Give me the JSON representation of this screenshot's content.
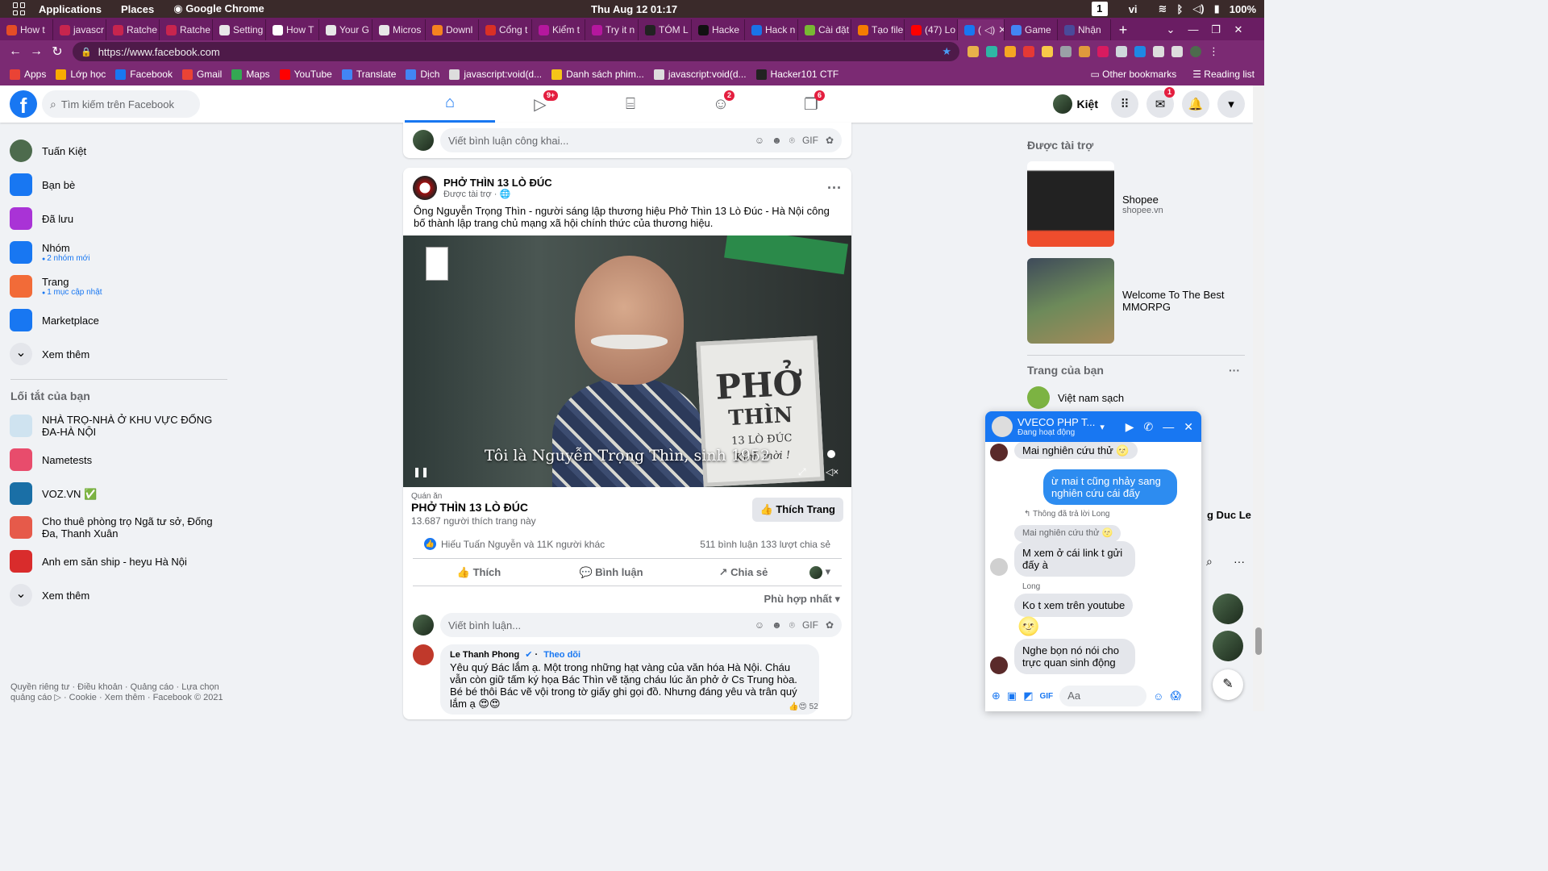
{
  "system": {
    "menus": [
      "Applications",
      "Places",
      "Google Chrome"
    ],
    "clock": "Thu Aug 12  01:17",
    "workspace": "1",
    "lang": "vi",
    "battery": "100%"
  },
  "tabs": [
    {
      "label": "How t",
      "color": "#e44d26"
    },
    {
      "label": "javascr",
      "color": "#c7254e"
    },
    {
      "label": "Ratche",
      "color": "#c7254e"
    },
    {
      "label": "Ratche",
      "color": "#c7254e"
    },
    {
      "label": "Setting",
      "color": "#e7e7e7"
    },
    {
      "label": "How T",
      "color": "#ffffff"
    },
    {
      "label": "Your G",
      "color": "#e7e7e7"
    },
    {
      "label": "Micros",
      "color": "#e7e7e7"
    },
    {
      "label": "Downl",
      "color": "#f58220"
    },
    {
      "label": "Cổng t",
      "color": "#d93025"
    },
    {
      "label": "Kiểm t",
      "color": "#b5179e"
    },
    {
      "label": "Try it n",
      "color": "#b5179e"
    },
    {
      "label": "TÓM L",
      "color": "#222222"
    },
    {
      "label": "Hacke",
      "color": "#111111"
    },
    {
      "label": "Hack n",
      "color": "#1a73e8"
    },
    {
      "label": "Cài đặt",
      "color": "#78b833"
    },
    {
      "label": "Tạo file",
      "color": "#f57c00"
    },
    {
      "label": "(47) Lo",
      "color": "#ff0000"
    },
    {
      "label": "(",
      "color": "#1877f2"
    },
    {
      "label": "Game",
      "color": "#4285f4"
    },
    {
      "label": "Nhận",
      "color": "#4a4a9a"
    }
  ],
  "omnibox": {
    "url": "https://www.facebook.com"
  },
  "bookmarks": [
    {
      "label": "Apps",
      "color": "#ea4335"
    },
    {
      "label": "Lớp học",
      "color": "#f9ab00"
    },
    {
      "label": "Facebook",
      "color": "#1877f2"
    },
    {
      "label": "Gmail",
      "color": "#ea4335"
    },
    {
      "label": "Maps",
      "color": "#34a853"
    },
    {
      "label": "YouTube",
      "color": "#ff0000"
    },
    {
      "label": "Translate",
      "color": "#4285f4"
    },
    {
      "label": "Dịch",
      "color": "#4285f4"
    },
    {
      "label": "javascript:void(d...",
      "color": "#dddddd"
    },
    {
      "label": "Danh sách phim...",
      "color": "#f5c518"
    },
    {
      "label": "javascript:void(d...",
      "color": "#dddddd"
    },
    {
      "label": "Hacker101 CTF",
      "color": "#222222"
    }
  ],
  "bookmarks_right": [
    "Other bookmarks",
    "Reading list"
  ],
  "fb": {
    "search_placeholder": "Tìm kiếm trên Facebook",
    "nav_badges": {
      "watch": "9+",
      "groups": "2",
      "gaming": "6"
    },
    "profile_name": "Kiệt",
    "messenger_badge": "1"
  },
  "left": {
    "items": [
      {
        "label": "Tuấn Kiệt",
        "sub": "",
        "color": "#4d6b4d"
      },
      {
        "label": "Bạn bè",
        "sub": "",
        "color": "#1877f2"
      },
      {
        "label": "Đã lưu",
        "sub": "",
        "color": "#a933d6"
      },
      {
        "label": "Nhóm",
        "sub": "2 nhóm mới",
        "color": "#1877f2"
      },
      {
        "label": "Trang",
        "sub": "1 mục cập nhật",
        "color": "#f26b38"
      },
      {
        "label": "Marketplace",
        "sub": "",
        "color": "#1877f2"
      },
      {
        "label": "Xem thêm",
        "sub": "",
        "color": "#e4e6eb"
      }
    ],
    "shortcuts_title": "Lối tắt của bạn",
    "shortcuts": [
      {
        "label": "NHÀ TRỌ-NHÀ Ở KHU VỰC ĐỐNG ĐA-HÀ NỘI",
        "color": "#cfe3f0"
      },
      {
        "label": "Nametests",
        "color": "#e84c6c"
      },
      {
        "label": "VOZ.VN ✅",
        "color": "#1a6fa6"
      },
      {
        "label": "Cho thuê phòng trọ Ngã tư sở, Đống Đa, Thanh Xuân",
        "color": "#e65a4a"
      },
      {
        "label": "Anh em săn ship - heyu Hà Nội",
        "color": "#d92c2c"
      },
      {
        "label": "Xem thêm",
        "color": "#e4e6eb"
      }
    ],
    "footer": "Quyền riêng tư · Điều khoản · Quảng cáo · Lựa chọn quảng cáo ▷ · Cookie · Xem thêm · Facebook © 2021"
  },
  "feed": {
    "top_comment_placeholder": "Viết bình luận công khai...",
    "post": {
      "author": "PHỞ THÌN 13 LÒ ĐÚC",
      "meta": "Được tài trợ · 🌐",
      "text": "Ông Nguyễn Trọng Thìn - người sáng lập thương hiệu Phở Thìn 13 Lò Đúc - Hà Nội công bố thành lập trang chủ mạng xã hội chính thức của thương hiệu.",
      "video_subtitle": "Tôi là Nguyễn Trọng Thìn, sinh 1952",
      "video_sign": [
        "PHỞ",
        "THÌN",
        "13 LÒ ĐÚC",
        "Kính mời !"
      ],
      "page_category": "Quán ăn",
      "page_name": "PHỞ THÌN 13 LÒ ĐÚC",
      "page_likes": "13.687 người thích trang này",
      "like_page_btn": "Thích Trang",
      "reactions": "Hiếu Tuấn Nguyễn và 11K người khác",
      "comments_shares": "511 bình luận  133 lượt chia sẻ",
      "actions": [
        "Thích",
        "Bình luận",
        "Chia sẻ"
      ],
      "sort": "Phù hợp nhất",
      "comment_placeholder": "Viết bình luận...",
      "comment": {
        "author": "Le Thanh Phong",
        "follow": "Theo dõi",
        "text": "Yêu quý Bác lắm ạ. Một trong những hạt vàng của văn hóa Hà Nội. Cháu vẫn còn giữ tấm ký họa Bác Thìn vẽ tặng cháu lúc ăn phở ở Cs Trung hòa. Bé bé thôi Bác vẽ vội trong tờ giấy ghi gọi đồ. Nhưng đáng yêu và trân quý lắm ạ 😍😍",
        "reaction_count": "52"
      }
    }
  },
  "right": {
    "sponsored_title": "Được tài trợ",
    "ads": [
      {
        "title": "Shopee",
        "url": "shopee.vn",
        "color": "#ee4d2d"
      },
      {
        "title": "Welcome To The Best MMORPG",
        "url": "",
        "color": "#6d8a5a"
      }
    ],
    "pages_title": "Trang của bạn",
    "page_item": "Việt nam sạch",
    "partial_contact": "g Duc Le"
  },
  "chat": {
    "title": "VVECO PHP T...",
    "status": "Đang hoạt động",
    "messages": [
      {
        "side": "in",
        "text": "Mai nghiên cứu thử 🌝"
      },
      {
        "side": "out",
        "text": "ừ mai t cũng nhảy sang nghiên cứu cái đấy"
      },
      {
        "side": "note",
        "text": "↰ Thông đã trả lời Long"
      },
      {
        "side": "quote",
        "text": "Mai nghiên cứu thử 🌝"
      },
      {
        "side": "in",
        "text": "M xem ở cái link t gửi đấy à"
      },
      {
        "side": "name",
        "text": "Long"
      },
      {
        "side": "in",
        "text": "Ko t xem trên youtube"
      },
      {
        "side": "in",
        "text": "Nghe bọn nó nói cho trực quan sinh động"
      }
    ],
    "input_placeholder": "Aa"
  }
}
